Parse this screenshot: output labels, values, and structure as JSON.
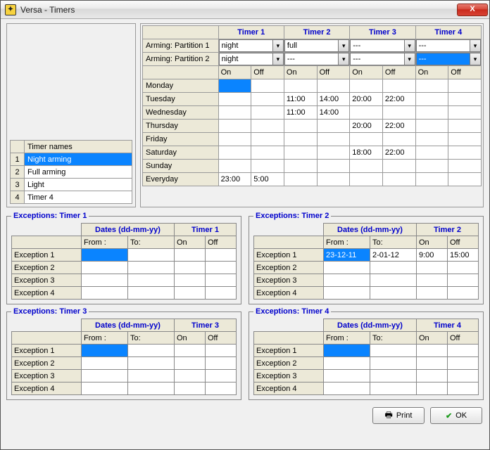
{
  "window": {
    "title": "Versa - Timers",
    "close": "X"
  },
  "timer_names": {
    "header": "Timer names",
    "rows": [
      "Night arming",
      "Full arming",
      "Light",
      "Timer 4"
    ],
    "selected_index": 0
  },
  "schedule": {
    "timers": [
      "Timer 1",
      "Timer 2",
      "Timer 3",
      "Timer 4"
    ],
    "arming_rows": [
      {
        "label": "Arming: Partition 1",
        "values": [
          "night",
          "full",
          "---",
          "---"
        ]
      },
      {
        "label": "Arming: Partition 2",
        "values": [
          "night",
          "---",
          "---",
          "---"
        ],
        "highlight_index": 3
      }
    ],
    "onoff": {
      "on": "On",
      "off": "Off"
    },
    "days": [
      {
        "label": "Monday",
        "cells": [
          "",
          "",
          "",
          "",
          "",
          "",
          "",
          ""
        ],
        "highlight_col": 0
      },
      {
        "label": "Tuesday",
        "cells": [
          "",
          "",
          "11:00",
          "14:00",
          "20:00",
          "22:00",
          "",
          ""
        ]
      },
      {
        "label": "Wednesday",
        "cells": [
          "",
          "",
          "11:00",
          "14:00",
          "",
          "",
          "",
          ""
        ]
      },
      {
        "label": "Thursday",
        "cells": [
          "",
          "",
          "",
          "",
          "20:00",
          "22:00",
          "",
          ""
        ]
      },
      {
        "label": "Friday",
        "cells": [
          "",
          "",
          "",
          "",
          "",
          "",
          "",
          ""
        ]
      },
      {
        "label": "Saturday",
        "cells": [
          "",
          "",
          "",
          "",
          "18:00",
          "22:00",
          "",
          ""
        ]
      },
      {
        "label": "Sunday",
        "cells": [
          "",
          "",
          "",
          "",
          "",
          "",
          "",
          ""
        ]
      },
      {
        "label": "Everyday",
        "cells": [
          "23:00",
          "5:00",
          "",
          "",
          "",
          "",
          "",
          ""
        ]
      }
    ]
  },
  "exceptions_meta": {
    "dates_label": "Dates (dd-mm-yy)",
    "from": "From :",
    "to": "To:",
    "on": "On",
    "off": "Off"
  },
  "exceptions": [
    {
      "title": "Exceptions: Timer 1",
      "timer_col": "Timer 1",
      "rows": [
        {
          "label": "Exception 1",
          "from": "",
          "to": "",
          "on": "",
          "off": "",
          "highlight_from": true
        },
        {
          "label": "Exception 2",
          "from": "",
          "to": "",
          "on": "",
          "off": ""
        },
        {
          "label": "Exception 3",
          "from": "",
          "to": "",
          "on": "",
          "off": ""
        },
        {
          "label": "Exception 4",
          "from": "",
          "to": "",
          "on": "",
          "off": ""
        }
      ]
    },
    {
      "title": "Exceptions: Timer 2",
      "timer_col": "Timer 2",
      "rows": [
        {
          "label": "Exception 1",
          "from": "23-12-11",
          "to": "2-01-12",
          "on": "9:00",
          "off": "15:00",
          "highlight_from": true
        },
        {
          "label": "Exception 2",
          "from": "",
          "to": "",
          "on": "",
          "off": ""
        },
        {
          "label": "Exception 3",
          "from": "",
          "to": "",
          "on": "",
          "off": ""
        },
        {
          "label": "Exception 4",
          "from": "",
          "to": "",
          "on": "",
          "off": ""
        }
      ]
    },
    {
      "title": "Exceptions: Timer 3",
      "timer_col": "Timer 3",
      "rows": [
        {
          "label": "Exception 1",
          "from": "",
          "to": "",
          "on": "",
          "off": "",
          "highlight_from": true
        },
        {
          "label": "Exception 2",
          "from": "",
          "to": "",
          "on": "",
          "off": ""
        },
        {
          "label": "Exception 3",
          "from": "",
          "to": "",
          "on": "",
          "off": ""
        },
        {
          "label": "Exception 4",
          "from": "",
          "to": "",
          "on": "",
          "off": ""
        }
      ]
    },
    {
      "title": "Exceptions: Timer 4",
      "timer_col": "Timer 4",
      "rows": [
        {
          "label": "Exception 1",
          "from": "",
          "to": "",
          "on": "",
          "off": "",
          "highlight_from": true
        },
        {
          "label": "Exception 2",
          "from": "",
          "to": "",
          "on": "",
          "off": ""
        },
        {
          "label": "Exception 3",
          "from": "",
          "to": "",
          "on": "",
          "off": ""
        },
        {
          "label": "Exception 4",
          "from": "",
          "to": "",
          "on": "",
          "off": ""
        }
      ]
    }
  ],
  "buttons": {
    "print": "Print",
    "ok": "OK"
  }
}
